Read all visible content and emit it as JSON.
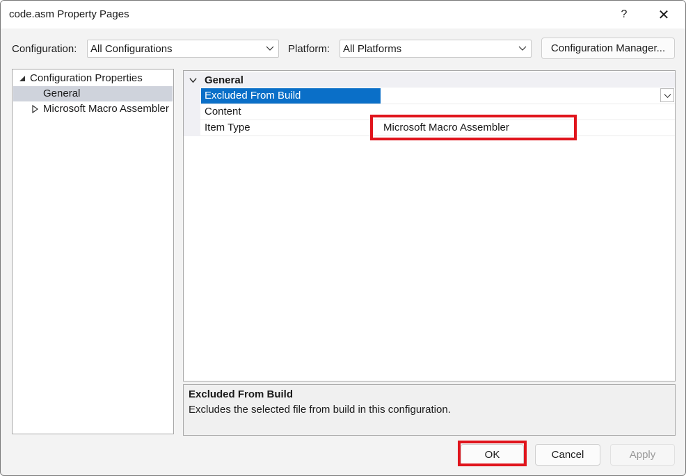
{
  "window": {
    "title": "code.asm Property Pages",
    "help_label": "?",
    "close_label": "✕"
  },
  "toolbar": {
    "configuration_label": "Configuration:",
    "configuration_value": "All Configurations",
    "platform_label": "Platform:",
    "platform_value": "All Platforms",
    "config_manager_label": "Configuration Manager..."
  },
  "tree": {
    "items": [
      {
        "label": "Configuration Properties",
        "expanded": true,
        "level": 0
      },
      {
        "label": "General",
        "selected": true,
        "level": 1
      },
      {
        "label": "Microsoft Macro Assembler",
        "expanded": false,
        "level": 1
      }
    ]
  },
  "grid": {
    "category": "General",
    "properties": [
      {
        "name": "Excluded From Build",
        "value": "",
        "selected": true
      },
      {
        "name": "Content",
        "value": ""
      },
      {
        "name": "Item Type",
        "value": "Microsoft Macro Assembler"
      }
    ]
  },
  "description": {
    "title": "Excluded From Build",
    "text": "Excludes the selected file from build in this configuration."
  },
  "buttons": {
    "ok": "OK",
    "cancel": "Cancel",
    "apply": "Apply"
  },
  "colors": {
    "selection": "#0a6fc8",
    "highlight_box": "#e0141c",
    "tree_selection": "#cfd3dc"
  }
}
